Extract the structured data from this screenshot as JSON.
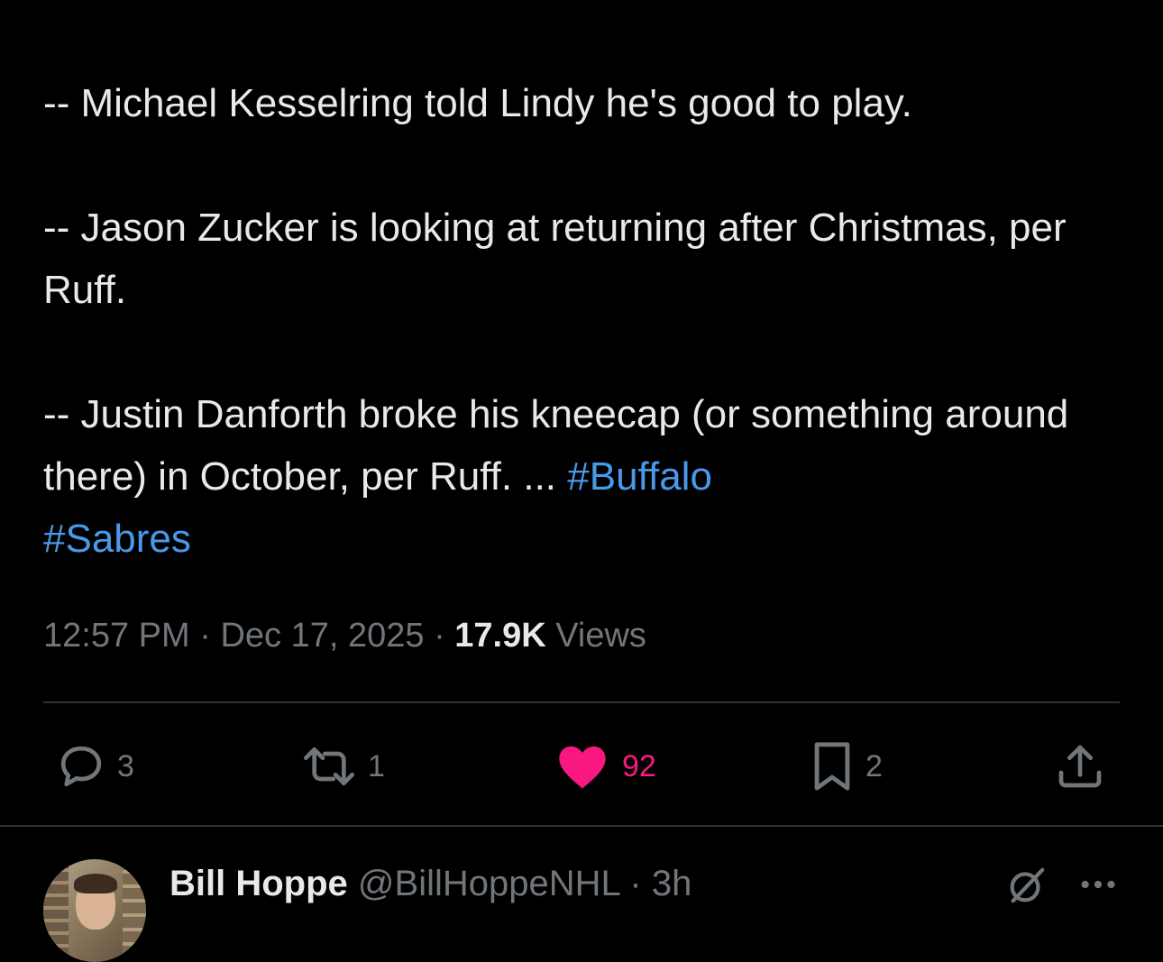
{
  "tweet": {
    "paragraphs": [
      "-- Michael Kesselring told Lindy he's good to play.",
      "-- Jason Zucker is looking at returning after Christmas, per Ruff.",
      "-- Justin Danforth broke his kneecap (or something around there) in October, per Ruff. ..."
    ],
    "hashtags": [
      "#Buffalo",
      "#Sabres"
    ],
    "time": "12:57 PM",
    "date": "Dec 17, 2025",
    "separator": "·",
    "views_count": "17.9K",
    "views_label": "Views"
  },
  "actions": {
    "replies": "3",
    "reposts": "1",
    "likes": "92",
    "bookmarks": "2"
  },
  "reply_tweet": {
    "name": "Bill Hoppe",
    "handle": "@BillHoppeNHL",
    "separator": "·",
    "time": "3h"
  },
  "colors": {
    "background": "#000000",
    "text": "#e7e9ea",
    "secondary": "#71767b",
    "link": "#4a99e9",
    "like": "#f91880",
    "divider": "#2f3336"
  },
  "icons": {
    "reply": "speech-bubble-icon",
    "repost": "repost-arrows-icon",
    "like": "heart-filled-icon",
    "bookmark": "bookmark-icon",
    "share": "share-upload-icon",
    "grok": "grok-slash-icon",
    "more": "more-dots-icon"
  }
}
